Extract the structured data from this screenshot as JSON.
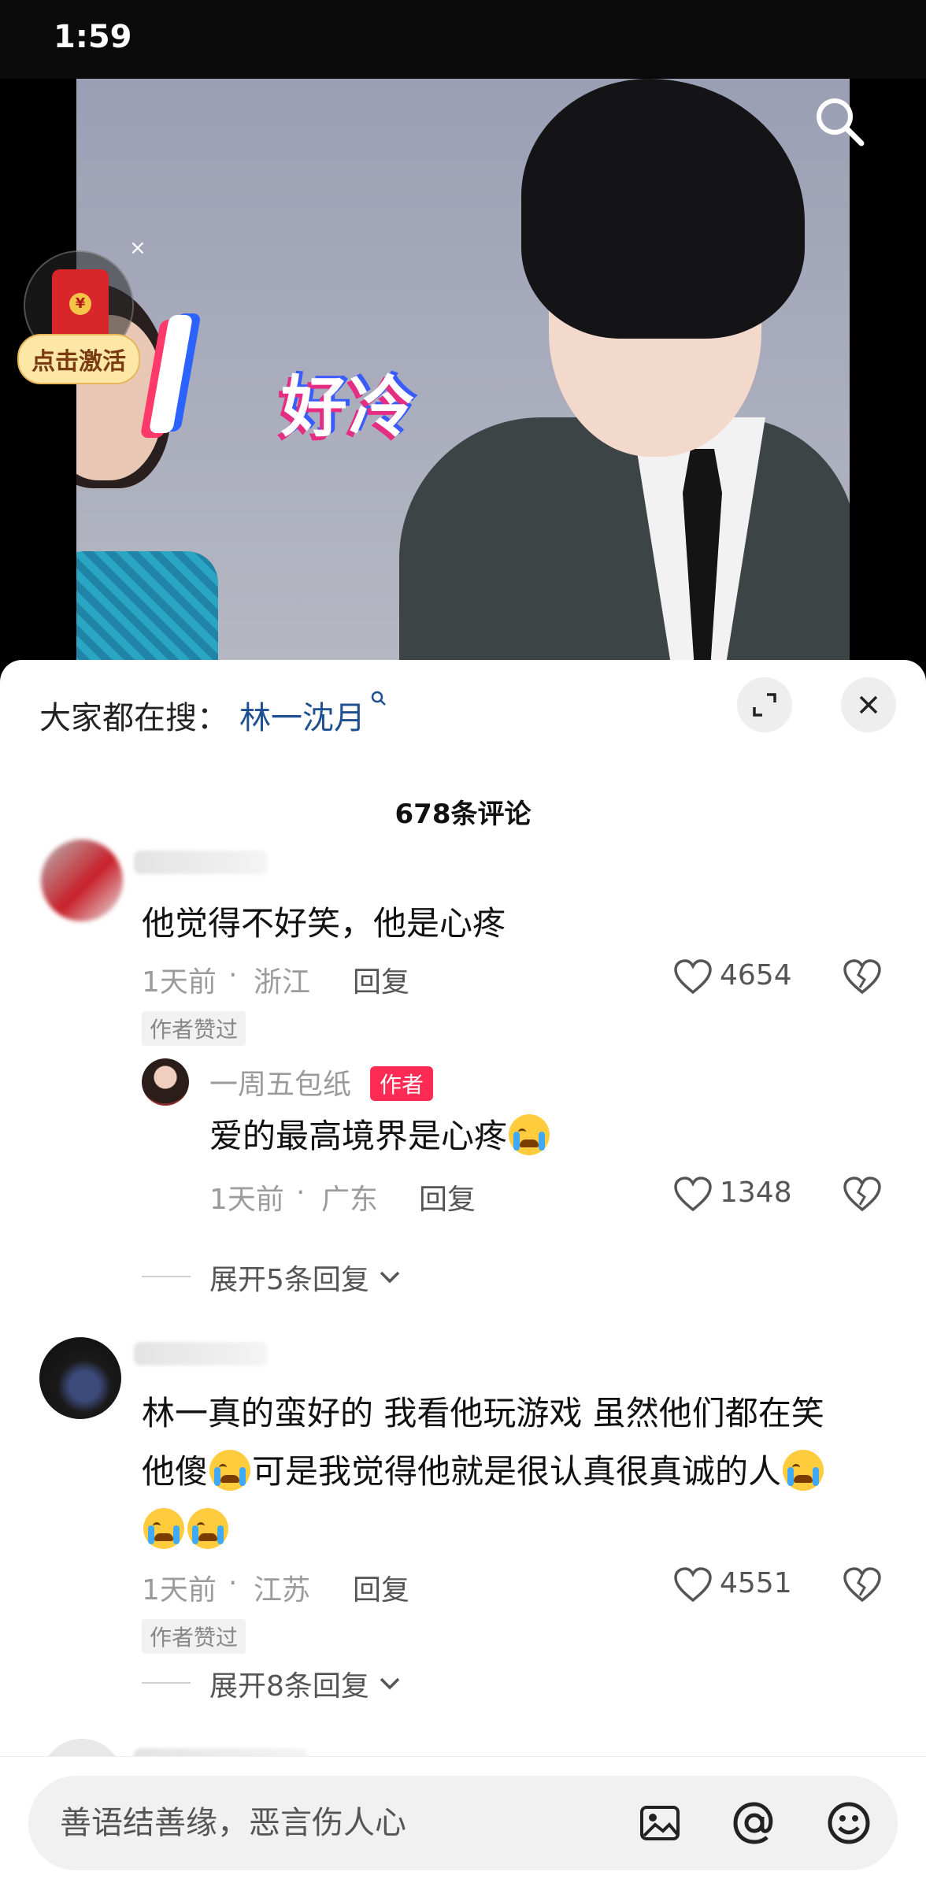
{
  "status_bar": {
    "time": "1:59"
  },
  "video": {
    "caption": "好冷"
  },
  "red_packet": {
    "label": "点击激活",
    "close": "×",
    "coin": "¥"
  },
  "search": {
    "label": "大家都在搜：",
    "term": "林一沈月",
    "mini_icon": "search-icon"
  },
  "comments_header": {
    "count": "678条评论"
  },
  "comments": [
    {
      "text": "他觉得不好笑，他是心疼",
      "time": "1天前",
      "location": "浙江",
      "reply": "回复",
      "likes": "4654",
      "author_liked": "作者赞过",
      "replies": [
        {
          "name": "一周五包纸",
          "tag": "作者",
          "text": "爱的最高境界是心疼",
          "time": "1天前",
          "location": "广东",
          "reply": "回复",
          "likes": "1348"
        }
      ],
      "expand": "展开5条回复"
    },
    {
      "text_line1": "林一真的蛮好的 我看他玩游戏 虽然他们都在笑",
      "text_line2a": "他傻",
      "text_line2b": "可是我觉得他就是很认真很真诚的人",
      "time": "1天前",
      "location": "江苏",
      "reply": "回复",
      "likes": "4551",
      "author_liked": "作者赞过",
      "expand": "展开8条回复"
    }
  ],
  "input": {
    "placeholder": "善语结善缘，恶言伤人心"
  },
  "colors": {
    "accent": "#fe2c55",
    "link": "#1d4f91",
    "emoji": "#ffcc3d"
  }
}
